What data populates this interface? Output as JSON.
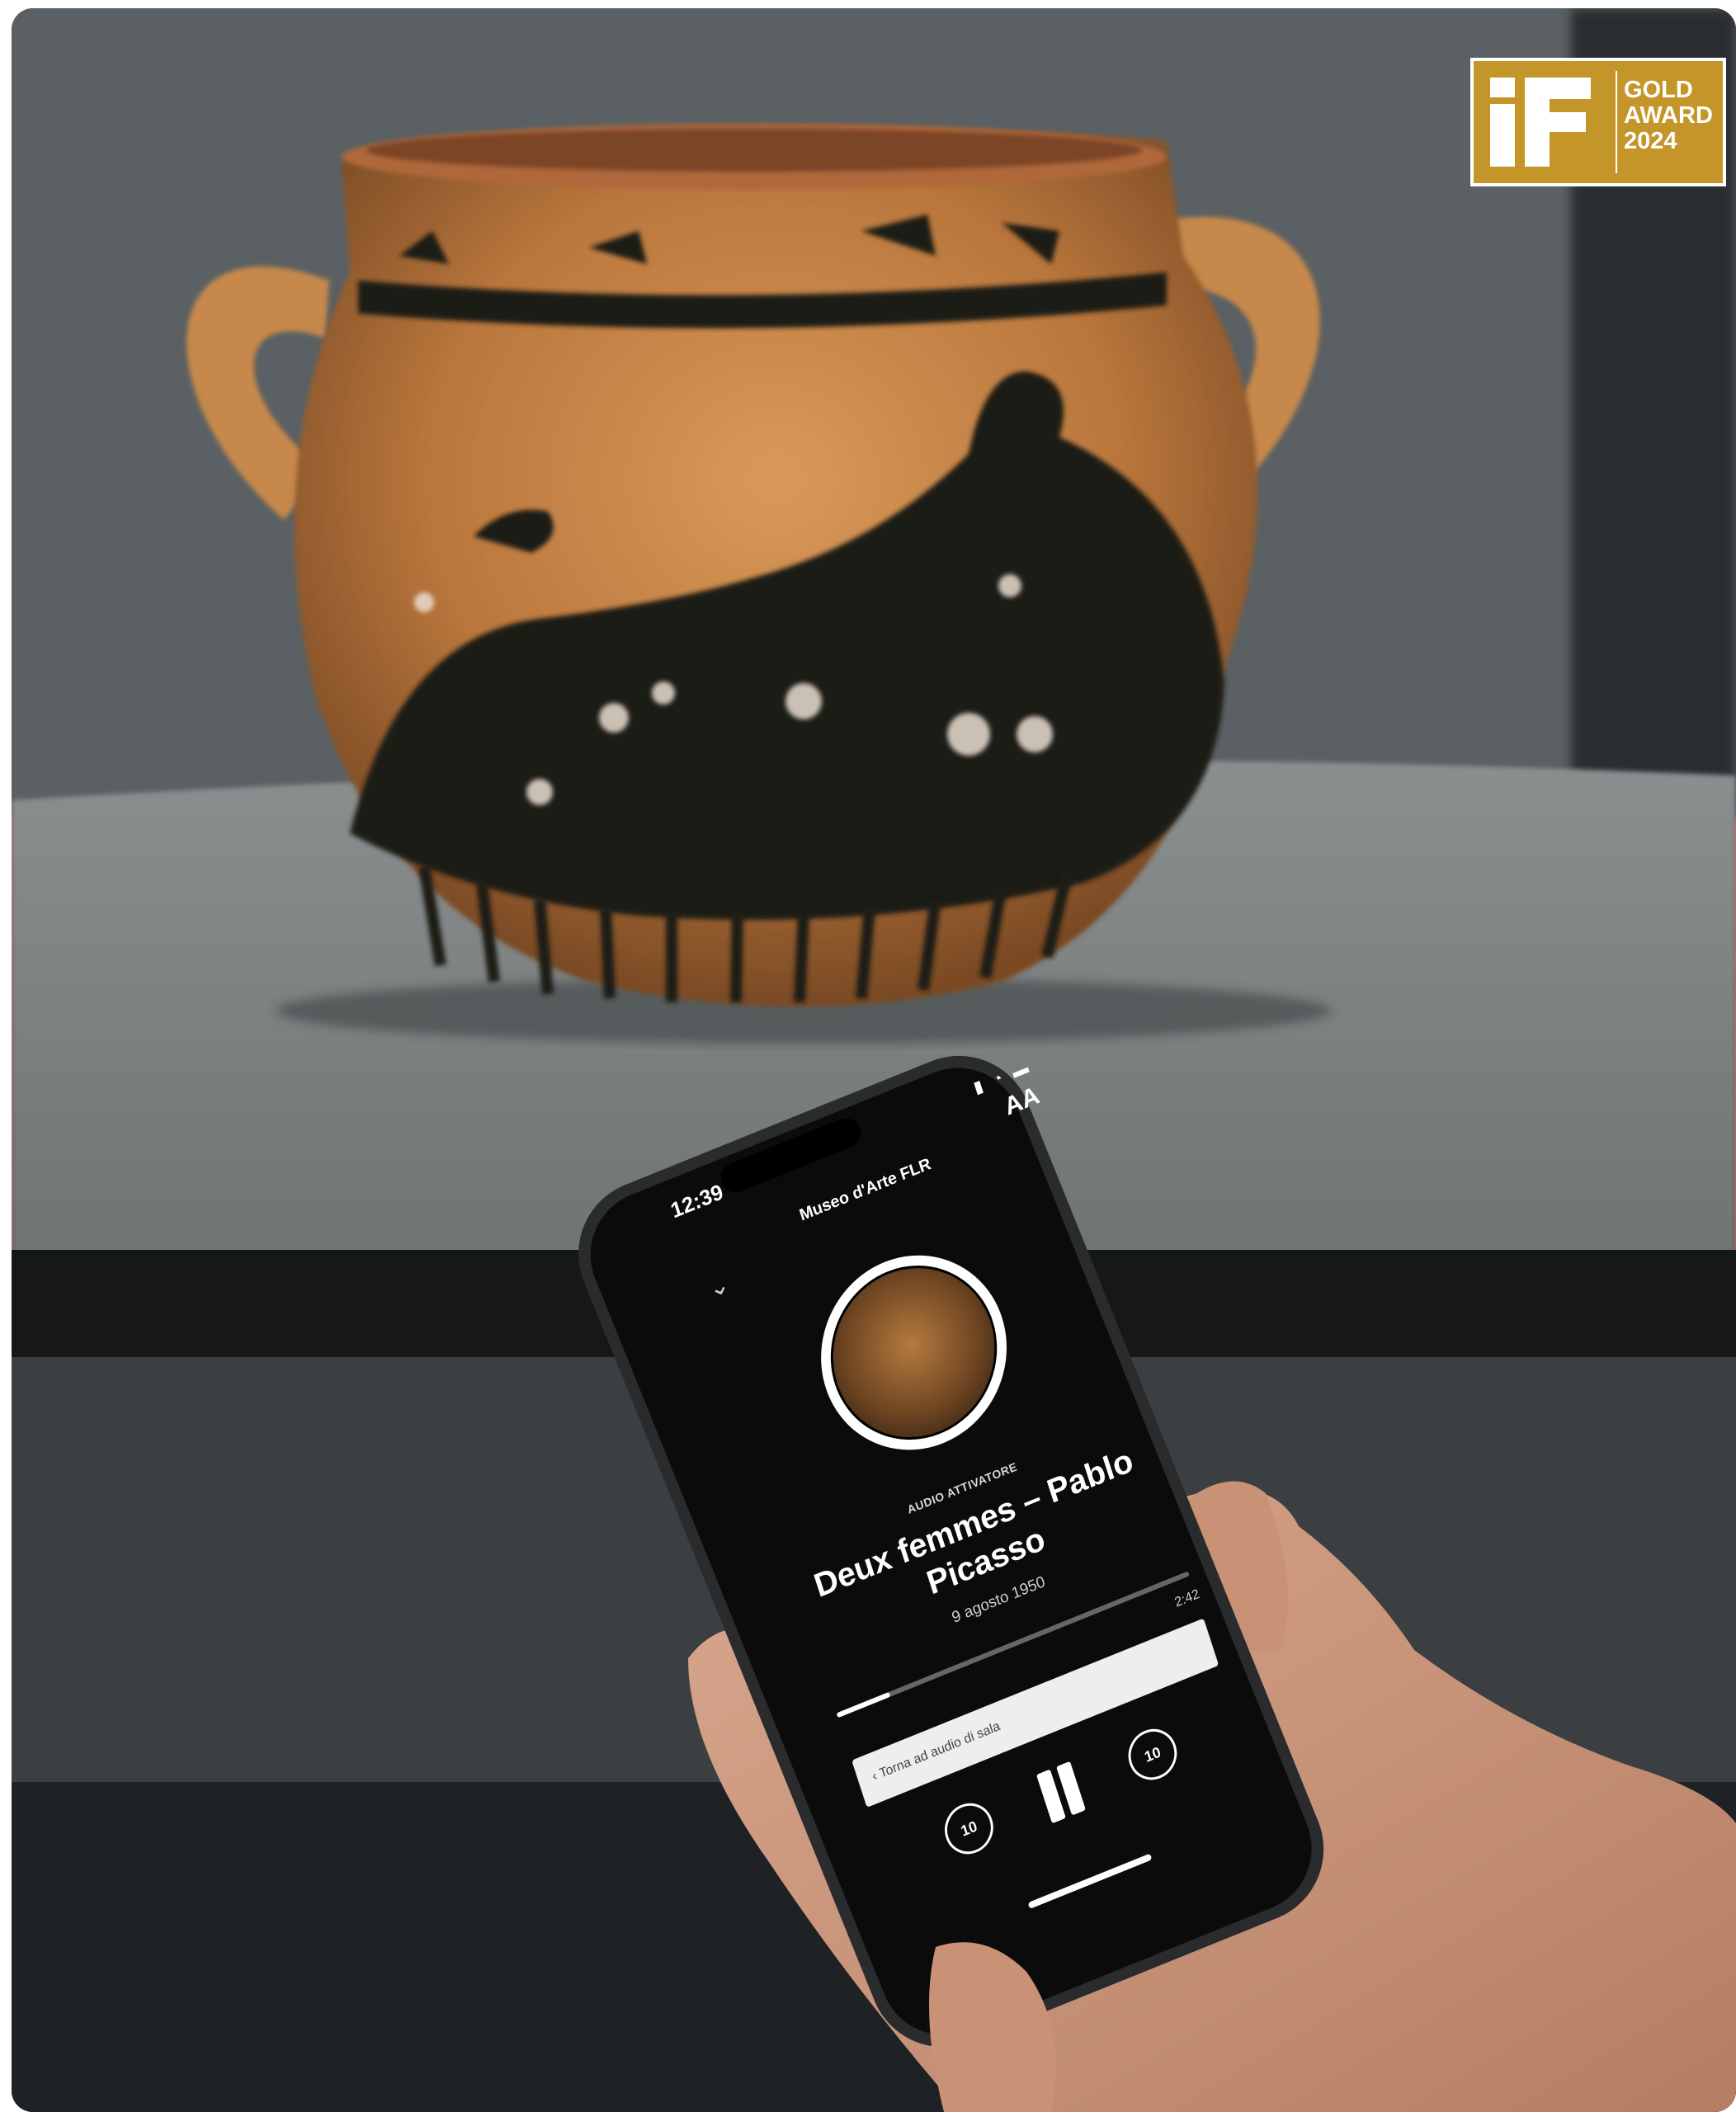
{
  "colors": {
    "badge_gold": "#c49629",
    "vase_terracotta": "#c07a3e",
    "vase_black_figure": "#1f1a16",
    "app_background": "#0b0b0b",
    "frame_border": "#e24a4a"
  },
  "badge": {
    "logo_text": "iF",
    "line1": "GOLD",
    "line2": "AWARD",
    "line3": "2024"
  },
  "phone": {
    "status_time": "12:39",
    "status_icons": "signal-icon wifi-icon battery-icon",
    "text_size_button": "AA",
    "venue_name": "Museo d'Arte FLR",
    "collapse_icon": "chevron-down-icon",
    "artwork_icon": "vase-thumbnail",
    "category": "AUDIO ATTIVATORE",
    "title": "Deux femmes – Pablo Picasso",
    "date": "9 agosto 1950",
    "progress_fraction": 0.15,
    "remaining_time": "2:42",
    "back_to_room_audio": "‹  Torna ad audio di sala",
    "rewind_label": "10",
    "forward_label": "10",
    "rewind_icon": "rewind-10-icon",
    "pause_icon": "pause-icon",
    "forward_icon": "forward-10-icon"
  }
}
